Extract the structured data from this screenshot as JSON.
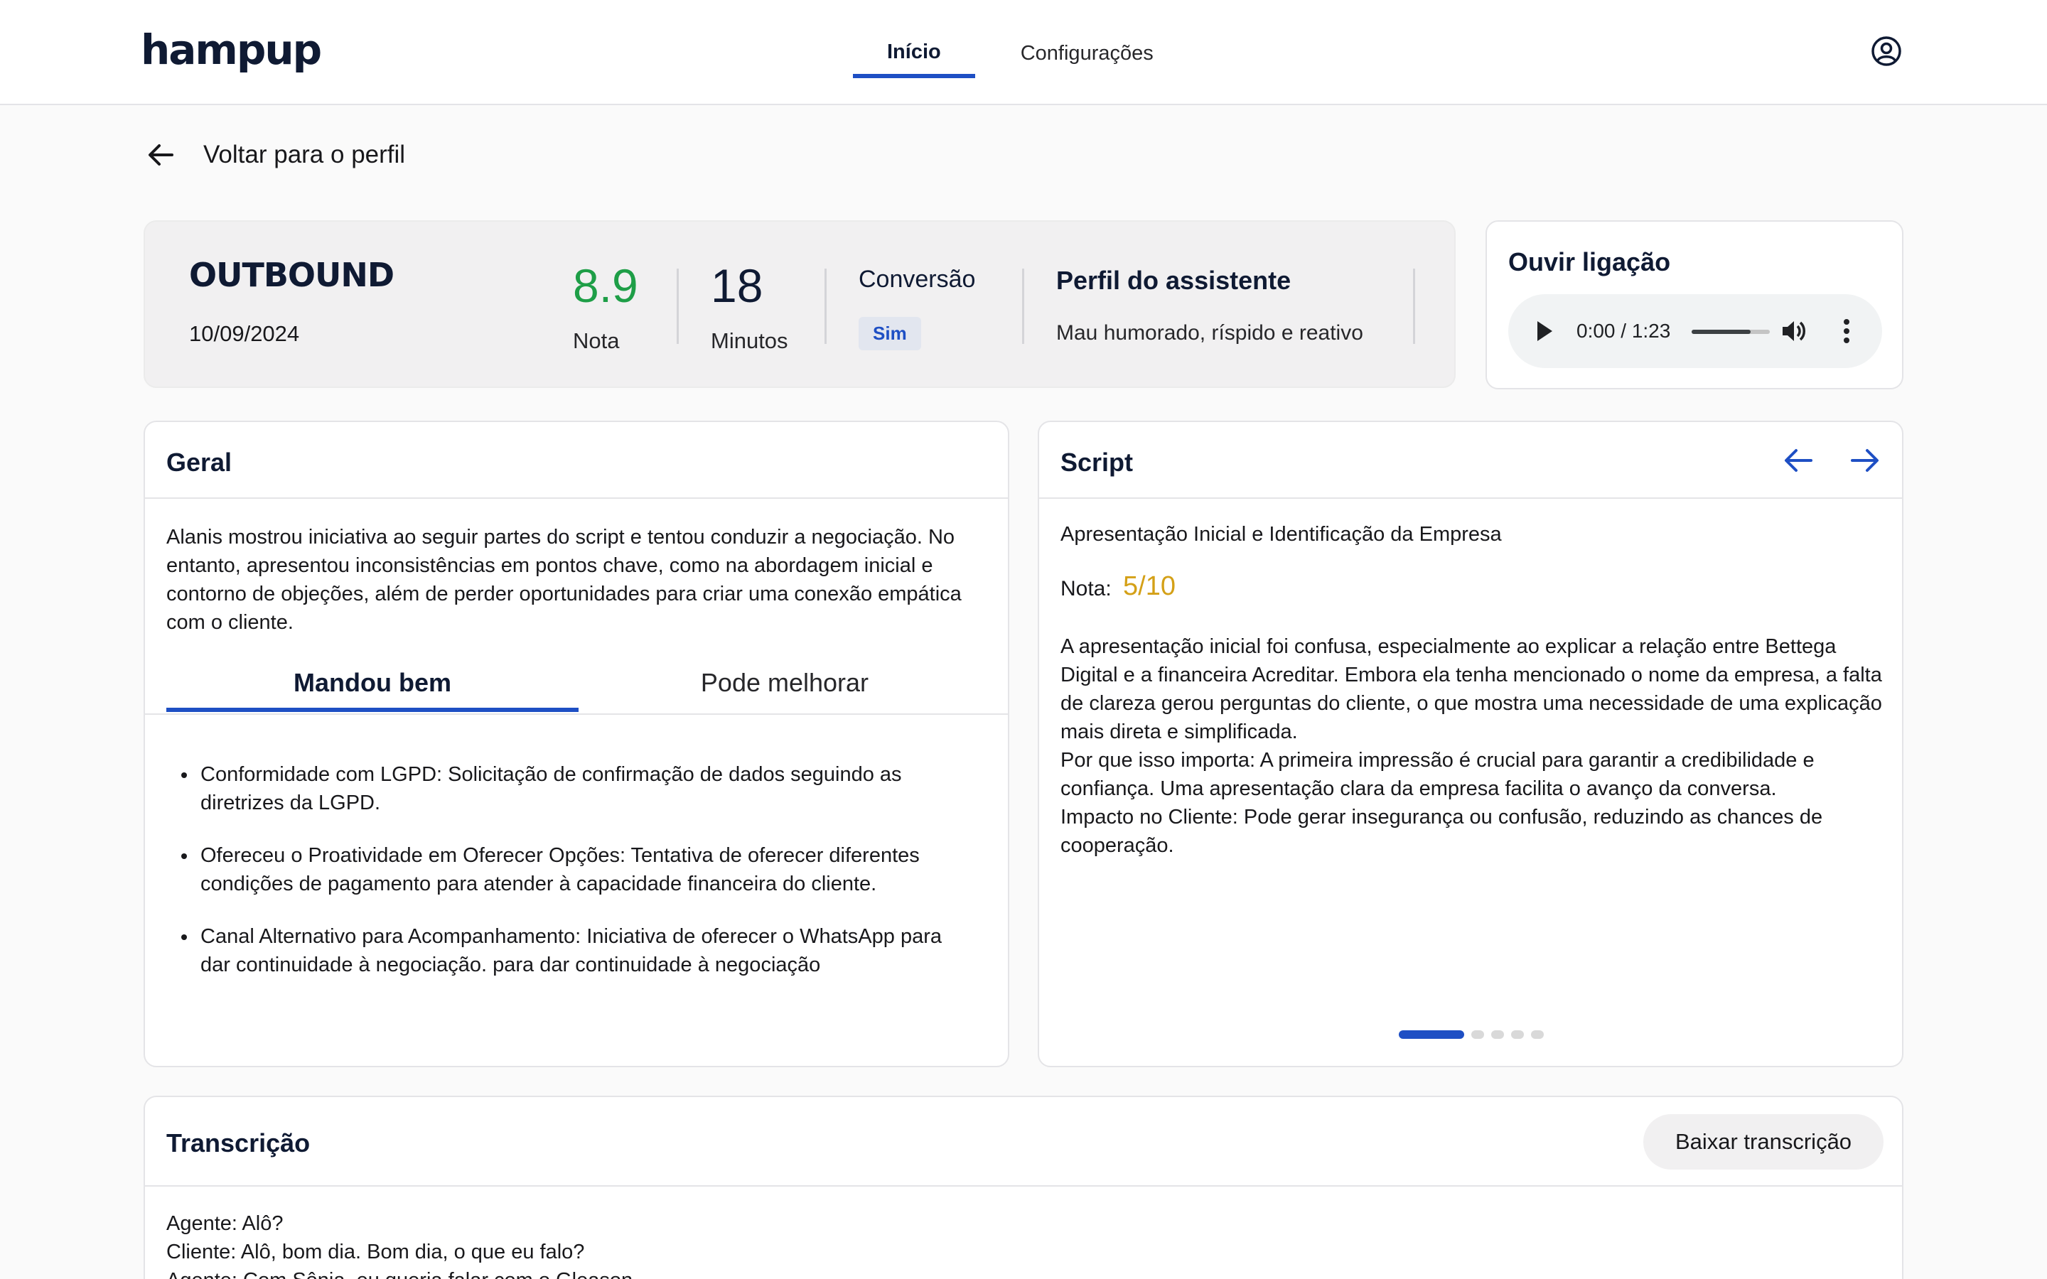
{
  "header": {
    "logo": "hampup",
    "nav": [
      {
        "label": "Início",
        "active": true
      },
      {
        "label": "Configurações",
        "active": false
      }
    ]
  },
  "back_link": "Voltar para o perfil",
  "summary": {
    "campaign": "OUTBOUND",
    "date": "10/09/2024",
    "score": "8.9",
    "score_label": "Nota",
    "minutes": "18",
    "minutes_label": "Minutos",
    "conversion_title": "Conversão",
    "conversion_value": "Sim",
    "profile_title": "Perfil do assistente",
    "profile_text": "Mau humorado, ríspido e reativo",
    "score_color": "#1e9e47"
  },
  "listen": {
    "title": "Ouvir ligação",
    "time": "0:00 / 1:23",
    "volume_level": 0.75
  },
  "geral": {
    "title": "Geral",
    "summary": "Alanis mostrou iniciativa ao seguir partes do script e tentou conduzir a negociação. No entanto, apresentou inconsistências em pontos chave, como na abordagem inicial e contorno de objeções, além de perder oportunidades para criar uma conexão empática com o cliente.",
    "tabs": [
      {
        "label": "Mandou bem",
        "active": true
      },
      {
        "label": "Pode melhorar",
        "active": false
      }
    ],
    "bullets": [
      "Conformidade com LGPD: Solicitação de confirmação de dados seguindo as diretrizes da LGPD.",
      "Ofereceu o Proatividade em Oferecer Opções: Tentativa de oferecer diferentes condições de pagamento para atender à capacidade financeira do cliente.",
      "Canal Alternativo para Acompanhamento: Iniciativa de oferecer o WhatsApp para dar continuidade à negociação. para dar continuidade à negociação"
    ]
  },
  "script": {
    "title": "Script",
    "subtitle": "Apresentação Inicial e Identificação da Empresa",
    "nota_label": "Nota:",
    "nota_value": "5/10",
    "nota_color": "#d4a017",
    "body": [
      "A apresentação inicial foi confusa, especialmente ao explicar a relação entre Bettega Digital e a financeira Acreditar. Embora ela tenha mencionado o nome da empresa, a falta de clareza gerou perguntas do cliente, o que mostra uma necessidade de uma explicação mais direta e simplificada.",
      "Por que isso importa: A primeira impressão é crucial para garantir a credibilidade e confiança. Uma apresentação clara da empresa facilita o avanço da conversa.",
      "Impacto no Cliente: Pode gerar insegurança ou confusão, reduzindo as chances de cooperação."
    ],
    "pages": 5,
    "current_page": 1
  },
  "transcription": {
    "title": "Transcrição",
    "download_label": "Baixar transcrição",
    "lines": [
      "Agente: Alô?",
      "Cliente: Alô, bom dia. Bom dia, o que eu falo?",
      "Agente: Com Sônia, eu queria falar com o Gleason."
    ]
  },
  "accent_color": "#1e4fc4"
}
